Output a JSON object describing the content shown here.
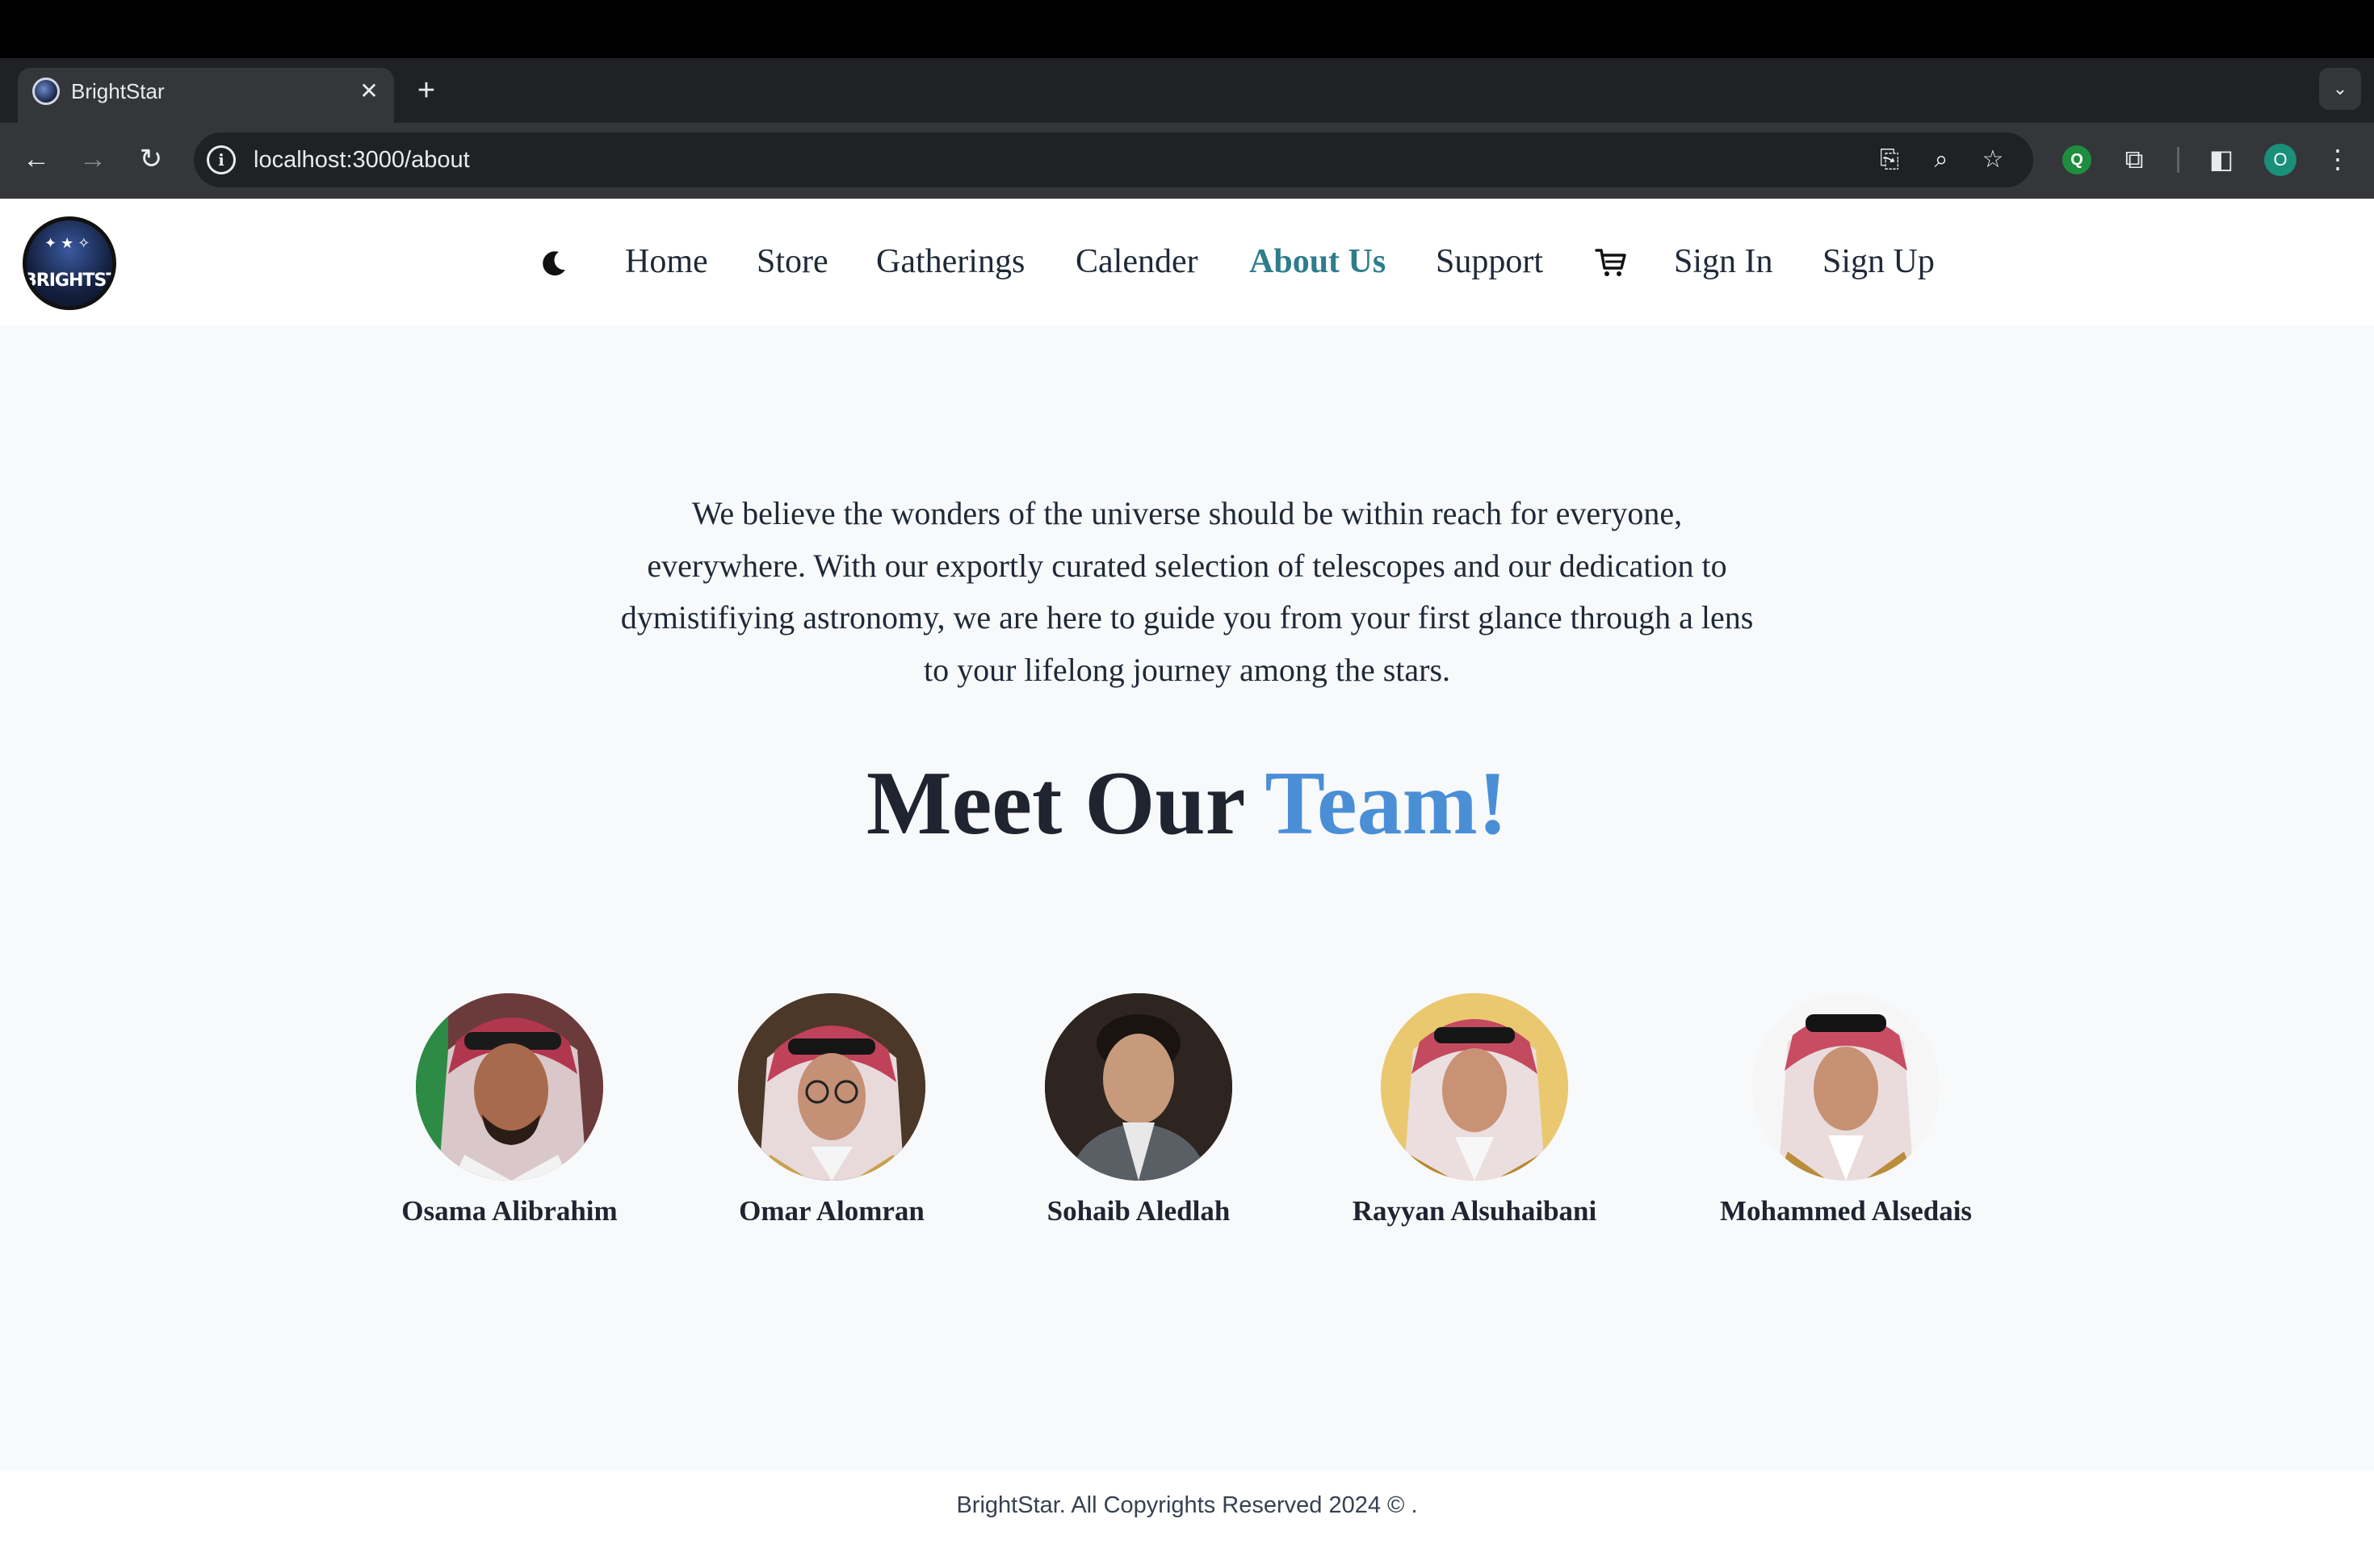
{
  "browser": {
    "tab_title": "BrightStar",
    "url": "localhost:3000/about",
    "profile_initial": "O",
    "extension_letter": "Q"
  },
  "nav": {
    "items": [
      {
        "label": "Home",
        "active": false
      },
      {
        "label": "Store",
        "active": false
      },
      {
        "label": "Gatherings",
        "active": false
      },
      {
        "label": "Calender",
        "active": false
      },
      {
        "label": "About Us",
        "active": true
      },
      {
        "label": "Support",
        "active": false
      },
      {
        "label": "Sign In",
        "active": false
      },
      {
        "label": "Sign Up",
        "active": false
      }
    ],
    "logo_text": "BRIGHTSTAR"
  },
  "intro": {
    "text": "We believe the wonders of the universe should be within reach for everyone, everywhere. With our exportly curated selection of telescopes and our dedication to dymistifiying astronomy, we are here to guide you from your first glance through a lens to your lifelong journey among the stars."
  },
  "team": {
    "heading_main": "Meet Our",
    "heading_accent": "Team!",
    "members": [
      {
        "name": "Osama Alibrahim"
      },
      {
        "name": "Omar Alomran"
      },
      {
        "name": "Sohaib Aledlah"
      },
      {
        "name": "Rayyan Alsuhaibani"
      },
      {
        "name": "Mohammed Alsedais"
      }
    ]
  },
  "footer": {
    "text": "BrightStar. All Copyrights Reserved 2024 © ."
  },
  "colors": {
    "accent": "#4a8fd6",
    "active_nav": "#2e7d8c",
    "text": "#1f2430"
  }
}
